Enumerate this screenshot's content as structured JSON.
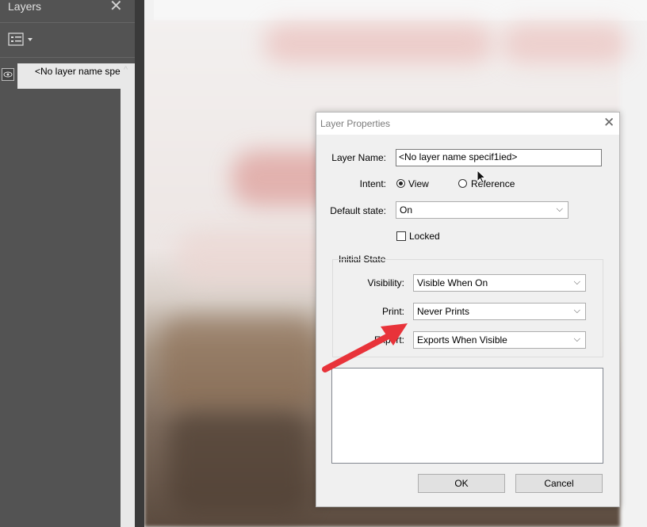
{
  "layers_panel": {
    "title": "Layers",
    "close_glyph": "✕",
    "menu_icon": "layer-options-icon",
    "layer_row_label": "<No layer name spec",
    "scroll_up_glyph": "^"
  },
  "dialog": {
    "title": "Layer Properties",
    "close_glyph": "✕",
    "layer_name_label": "Layer Name:",
    "layer_name_value": "<No layer name specif1ied>",
    "intent_label": "Intent:",
    "intent_options": [
      {
        "label": "View",
        "selected": true
      },
      {
        "label": "Reference",
        "selected": false
      }
    ],
    "default_state_label": "Default state:",
    "default_state_value": "On",
    "locked_label": "Locked",
    "locked_checked": false,
    "initial_state": {
      "legend": "Initial State",
      "visibility_label": "Visibility:",
      "visibility_value": "Visible When On",
      "print_label": "Print:",
      "print_value": "Never Prints",
      "export_label": "Export:",
      "export_value": "Exports When Visible"
    },
    "ok_label": "OK",
    "cancel_label": "Cancel"
  },
  "annotation": {
    "arrow_color": "#e8333a"
  },
  "dropdown_glyph": "⌵"
}
